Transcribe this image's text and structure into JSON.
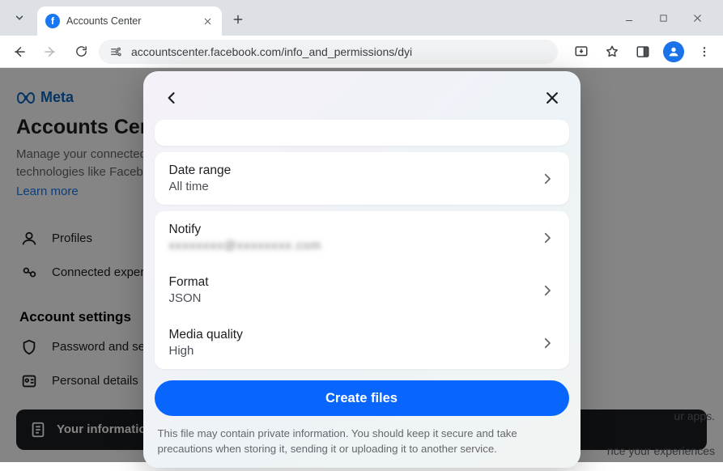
{
  "browser": {
    "tab_title": "Accounts Center",
    "url": "accountscenter.facebook.com/info_and_permissions/dyi"
  },
  "page": {
    "brand": "Meta",
    "title": "Accounts Center",
    "description": "Manage your connected experiences and account settings across Meta technologies like Facebook, Instagram and",
    "learn_more": "Learn more",
    "nav": {
      "profiles": "Profiles",
      "connected": "Connected experiences"
    },
    "section_heading": "Account settings",
    "settings": {
      "password": "Password and security",
      "personal": "Personal details"
    },
    "highlighted": "Your information and permissions",
    "side_text1": "ur apps.",
    "side_text2": "nce your experiences"
  },
  "modal": {
    "date_range": {
      "label": "Date range",
      "value": "All time"
    },
    "notify": {
      "label": "Notify",
      "value_masked": "xxxxxxxx@xxxxxxxx.com"
    },
    "format": {
      "label": "Format",
      "value": "JSON"
    },
    "media": {
      "label": "Media quality",
      "value": "High"
    },
    "cta": "Create files",
    "disclaimer": "This file may contain private information. You should keep it secure and take precautions when storing it, sending it or uploading it to another service."
  }
}
